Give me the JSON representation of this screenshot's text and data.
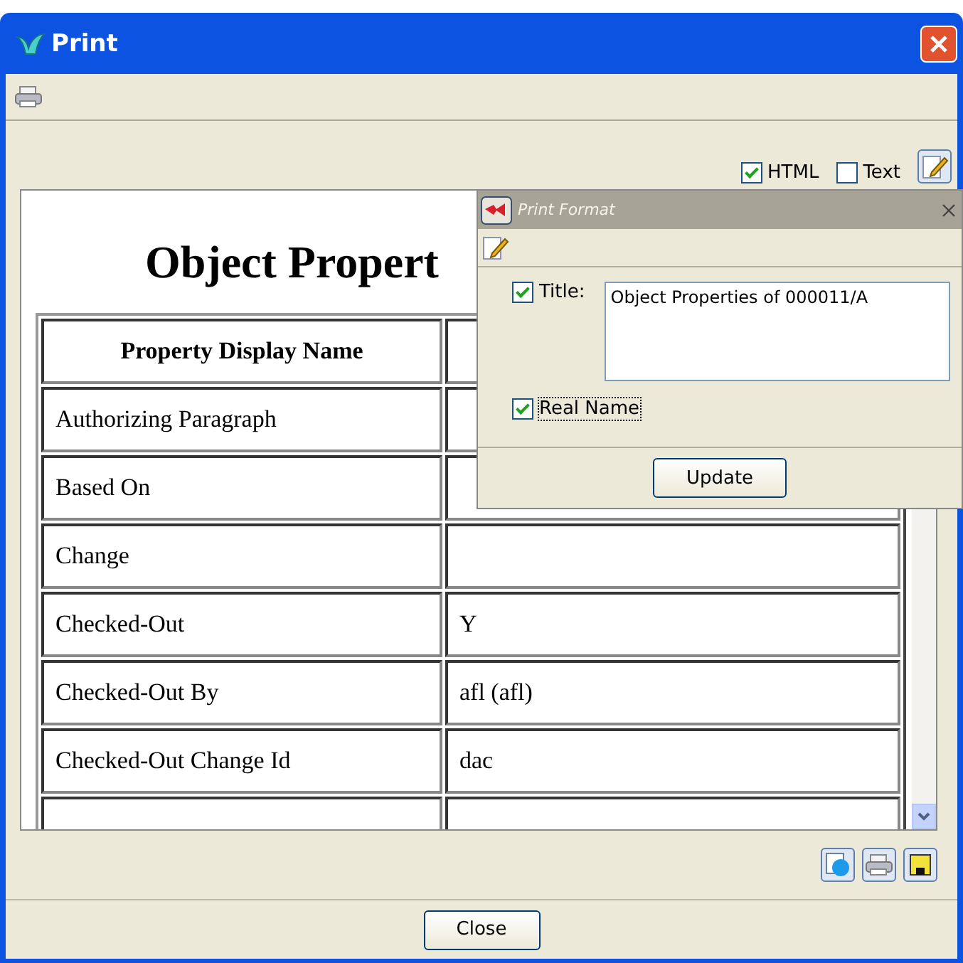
{
  "window": {
    "title": "Print"
  },
  "options": [
    {
      "label": "HTML",
      "checked": true
    },
    {
      "label": "Text",
      "checked": false
    }
  ],
  "document": {
    "title": "Object Propert",
    "columns": [
      "Property Display Name"
    ],
    "rows": [
      {
        "name": "Authorizing Paragraph"
      },
      {
        "name": "Based On"
      },
      {
        "name": "Change"
      },
      {
        "name": "Checked-Out",
        "value": "Y"
      },
      {
        "name": "Checked-Out By",
        "value": "afl (afl)"
      },
      {
        "name": "Checked-Out Change Id",
        "value": "dac"
      },
      {}
    ]
  },
  "print_format": {
    "title": "Print Format",
    "fields": [
      {
        "kind": "text",
        "label": "Title:",
        "checked": true,
        "value": "Object Properties of 000011/A"
      },
      {
        "kind": "check",
        "label": "Real Name",
        "checked": true
      }
    ],
    "button": "Update"
  },
  "buttons": [
    "Close"
  ]
}
